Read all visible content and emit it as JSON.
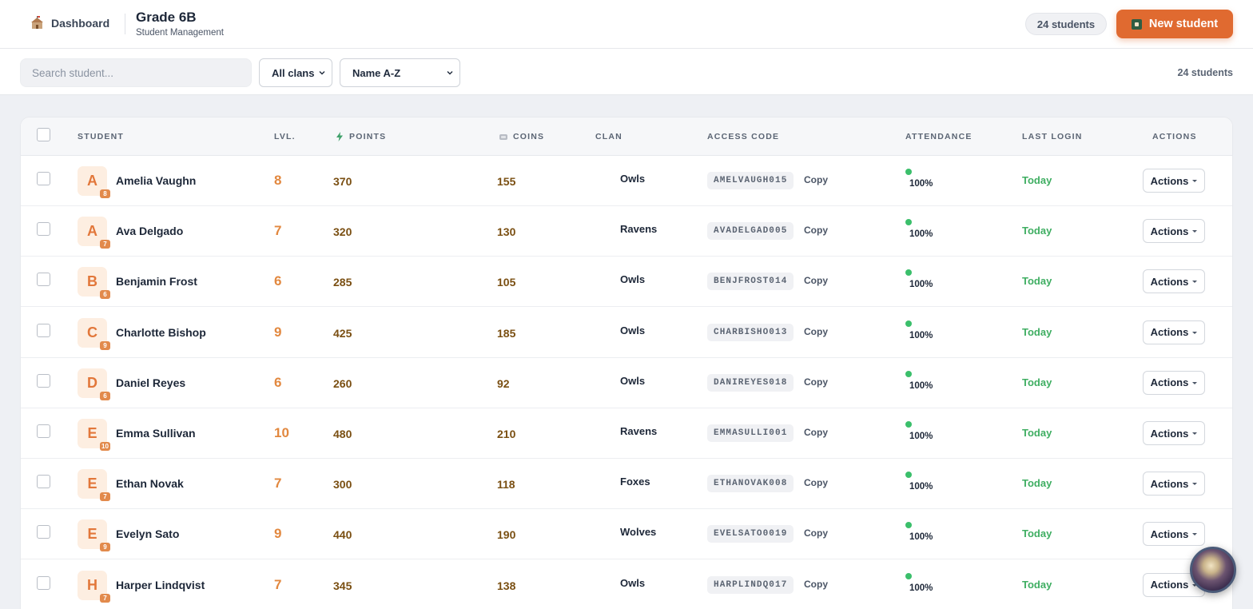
{
  "header": {
    "dashboard_label": "Dashboard",
    "title": "Grade 6B",
    "subtitle": "Student Management",
    "student_count": "24 students",
    "new_student_label": "New student"
  },
  "filters": {
    "search_placeholder": "Search student...",
    "clan_selected": "All clans",
    "sort_selected": "Name A-Z",
    "result_count": "24 students"
  },
  "table": {
    "headers": {
      "student": "STUDENT",
      "level": "LVL.",
      "points": "POINTS",
      "coins": "COINS",
      "clan": "CLAN",
      "access_code": "ACCESS CODE",
      "attendance": "ATTENDANCE",
      "last_login": "LAST LOGIN",
      "actions": "ACTIONS"
    },
    "copy_label": "Copy",
    "actions_label": "Actions",
    "rows": [
      {
        "initial": "A",
        "name": "Amelia Vaughn",
        "level": "8",
        "points": "370",
        "coins": "155",
        "clan": "Owls",
        "code": "AMELVAUGH015",
        "attendance": "100%",
        "last_login": "Today"
      },
      {
        "initial": "A",
        "name": "Ava Delgado",
        "level": "7",
        "points": "320",
        "coins": "130",
        "clan": "Ravens",
        "code": "AVADELGAD005",
        "attendance": "100%",
        "last_login": "Today"
      },
      {
        "initial": "B",
        "name": "Benjamin Frost",
        "level": "6",
        "points": "285",
        "coins": "105",
        "clan": "Owls",
        "code": "BENJFROST014",
        "attendance": "100%",
        "last_login": "Today"
      },
      {
        "initial": "C",
        "name": "Charlotte Bishop",
        "level": "9",
        "points": "425",
        "coins": "185",
        "clan": "Owls",
        "code": "CHARBISHO013",
        "attendance": "100%",
        "last_login": "Today"
      },
      {
        "initial": "D",
        "name": "Daniel Reyes",
        "level": "6",
        "points": "260",
        "coins": "92",
        "clan": "Owls",
        "code": "DANIREYES018",
        "attendance": "100%",
        "last_login": "Today"
      },
      {
        "initial": "E",
        "name": "Emma Sullivan",
        "level": "10",
        "points": "480",
        "coins": "210",
        "clan": "Ravens",
        "code": "EMMASULLI001",
        "attendance": "100%",
        "last_login": "Today"
      },
      {
        "initial": "E",
        "name": "Ethan Novak",
        "level": "7",
        "points": "300",
        "coins": "118",
        "clan": "Foxes",
        "code": "ETHANOVAK008",
        "attendance": "100%",
        "last_login": "Today"
      },
      {
        "initial": "E",
        "name": "Evelyn Sato",
        "level": "9",
        "points": "440",
        "coins": "190",
        "clan": "Wolves",
        "code": "EVELSATO0019",
        "attendance": "100%",
        "last_login": "Today"
      },
      {
        "initial": "H",
        "name": "Harper Lindqvist",
        "level": "7",
        "points": "345",
        "coins": "138",
        "clan": "Owls",
        "code": "HARPLINDQ017",
        "attendance": "100%",
        "last_login": "Today"
      }
    ]
  },
  "colors": {
    "accent": "#e06a30",
    "level": "#e2883f",
    "points": "#7a4f12",
    "login": "#3fae62",
    "attendance_dot": "#3bbf6b"
  }
}
